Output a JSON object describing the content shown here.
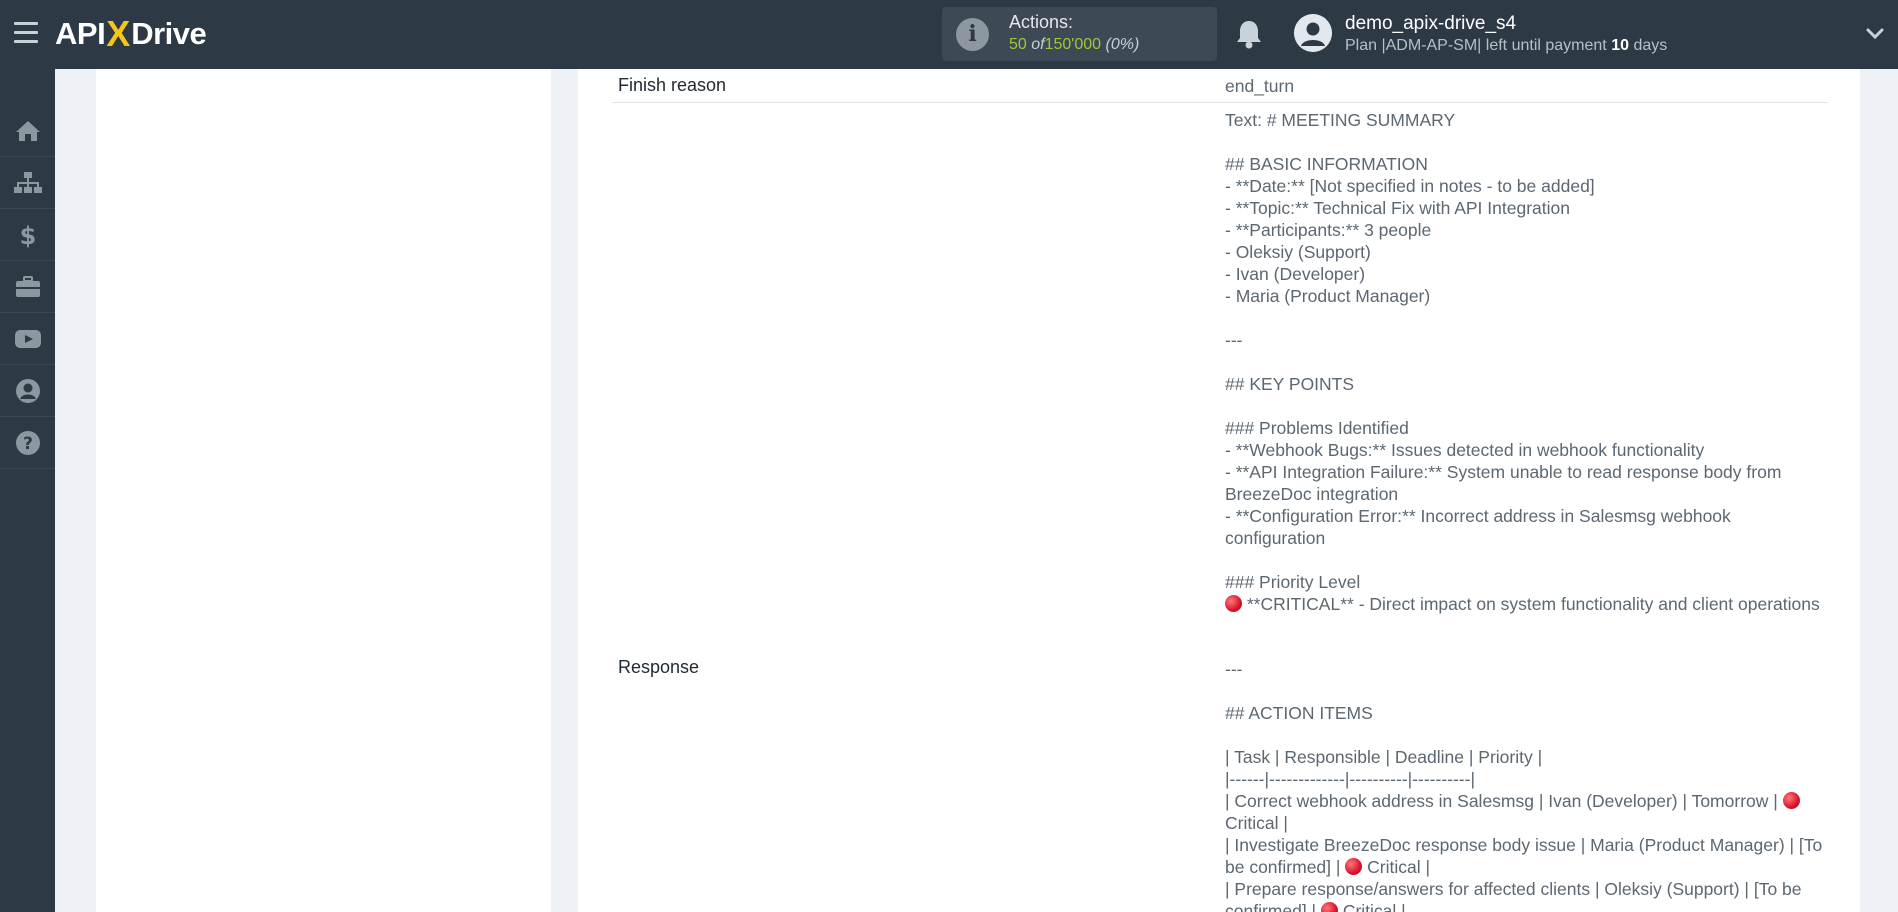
{
  "header": {
    "logo": {
      "part1": "API",
      "part2": "X",
      "part3": "Drive"
    },
    "actions": {
      "label": "Actions:",
      "used": "50",
      "of": "of",
      "total": "150'000",
      "percent": "(0%)"
    },
    "user": {
      "name": "demo_apix-drive_s4",
      "plan_prefix": "Plan |ADM-AP-SM| left until payment",
      "days": "10",
      "days_suffix": "days"
    }
  },
  "sidebar": {
    "items": [
      {
        "name": "home-icon"
      },
      {
        "name": "sitemap-icon"
      },
      {
        "name": "dollar-icon"
      },
      {
        "name": "briefcase-icon"
      },
      {
        "name": "youtube-icon"
      },
      {
        "name": "user-circle-icon"
      },
      {
        "name": "help-icon"
      }
    ]
  },
  "rows": {
    "finish_reason": {
      "label": "Finish reason",
      "value": "end_turn"
    },
    "text": {
      "value_before": "Text: # MEETING SUMMARY\n\n## BASIC INFORMATION\n- **Date:** [Not specified in notes - to be added]\n- **Topic:** Technical Fix with API Integration\n- **Participants:** 3 people\n- Oleksiy (Support)\n- Ivan (Developer)\n- Maria (Product Manager)\n\n---\n\n## KEY POINTS\n\n### Problems Identified\n- **Webhook Bugs:** Issues detected in webhook functionality\n- **API Integration Failure:** System unable to read response body from BreezeDoc integration\n- **Configuration Error:** Incorrect address in Salesmsg webhook configuration\n\n### Priority Level\n",
      "value_after": " **CRITICAL** - Direct impact on system functionality and client operations"
    },
    "response": {
      "label": "Response",
      "line1": "---\n\n## ACTION ITEMS\n\n| Task | Responsible | Deadline | Priority |\n|------|-------------|----------|----------|\n| Correct webhook address in Salesmsg | Ivan (Developer) | Tomorrow | ",
      "line1_end": " Critical |",
      "line2": "\n| Investigate BreezeDoc response body issue | Maria (Product Manager) | [To be confirmed] | ",
      "line2_end": " Critical |",
      "line3": "\n| Prepare response/answers for affected clients | Oleksiy (Support) | [To be confirmed] | ",
      "line3_end": " Critical |"
    }
  },
  "colors": {
    "topbar": "#2d3945",
    "accent_yellow": "#f5c518",
    "used_green": "#9ec934",
    "critical_red": "#d8132c"
  }
}
